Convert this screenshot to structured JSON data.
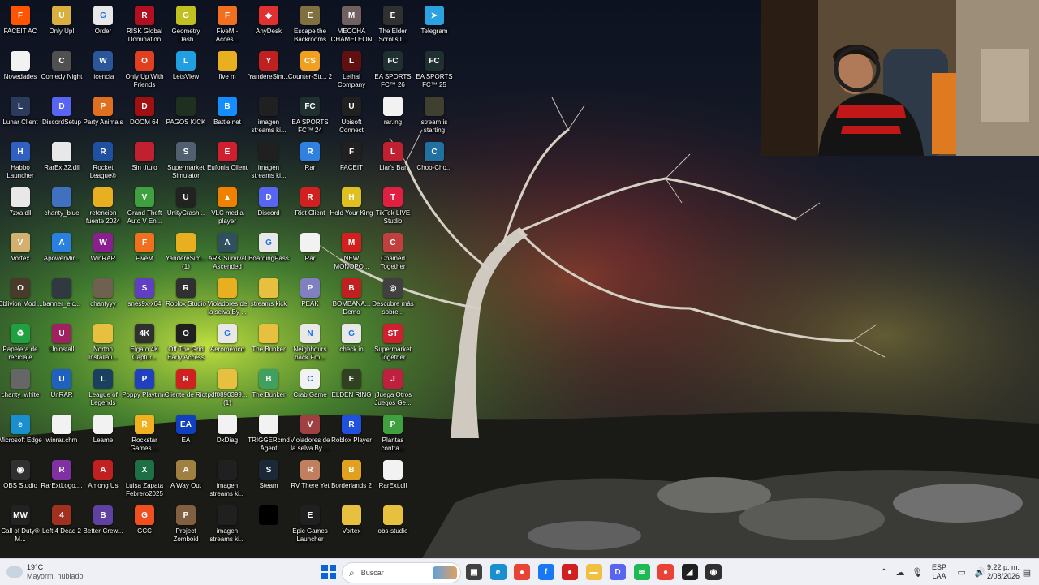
{
  "desktop": {
    "icons": [
      {
        "label": "FACEIT AC",
        "color": "#ff5500",
        "glyph": "F"
      },
      {
        "label": "Novedades",
        "color": "#f2f2f2",
        "glyph": ""
      },
      {
        "label": "Lunar Client",
        "color": "#2a3b5c",
        "glyph": "L"
      },
      {
        "label": "Habbo Launcher",
        "color": "#3060c0",
        "glyph": "H"
      },
      {
        "label": "7zxa.dll",
        "color": "#e8e8e8",
        "glyph": ""
      },
      {
        "label": "Vortex",
        "color": "#d4b070",
        "glyph": "V"
      },
      {
        "label": "Oblivion Mod ...",
        "color": "#4a3a2a",
        "glyph": "O"
      },
      {
        "label": "Papelera de reciclaje",
        "color": "#20a040",
        "glyph": "♻"
      },
      {
        "label": "chanty_white",
        "color": "#666666",
        "glyph": ""
      },
      {
        "label": "Microsoft Edge",
        "color": "#1a8fd0",
        "glyph": "e"
      },
      {
        "label": "OBS Studio",
        "color": "#303030",
        "glyph": "◉"
      },
      {
        "label": "Call of Duty® M...",
        "color": "#222222",
        "glyph": "MW"
      },
      {
        "label": "Only Up!",
        "color": "#d9b040",
        "glyph": "U"
      },
      {
        "label": "Comedy Night",
        "color": "#505050",
        "glyph": "C"
      },
      {
        "label": "DiscordSetup",
        "color": "#5865f2",
        "glyph": "D"
      },
      {
        "label": "RarExt32.dll",
        "color": "#e8e8e8",
        "glyph": ""
      },
      {
        "label": "chanty_blue",
        "color": "#4070c0",
        "glyph": ""
      },
      {
        "label": "ApowerMir...",
        "color": "#2a80e0",
        "glyph": "A"
      },
      {
        "label": "banner_elc...",
        "color": "#303840",
        "glyph": ""
      },
      {
        "label": "Uninstall",
        "color": "#a02060",
        "glyph": "U"
      },
      {
        "label": "UnRAR",
        "color": "#2060c0",
        "glyph": "U"
      },
      {
        "label": "winrar.chm",
        "color": "#f2f2f2",
        "glyph": ""
      },
      {
        "label": "RarExtLogo....",
        "color": "#8030a0",
        "glyph": "R"
      },
      {
        "label": "Left 4 Dead 2",
        "color": "#a03020",
        "glyph": "4"
      },
      {
        "label": "Order",
        "color": "#e8e8e8",
        "glyph": "G"
      },
      {
        "label": "licencia",
        "color": "#2b579a",
        "glyph": "W"
      },
      {
        "label": "Party Animals",
        "color": "#e07020",
        "glyph": "P"
      },
      {
        "label": "Rocket League®",
        "color": "#2050a0",
        "glyph": "R"
      },
      {
        "label": "retencion fuente 2024",
        "color": "#e8b020",
        "glyph": ""
      },
      {
        "label": "WinRAR",
        "color": "#8a2090",
        "glyph": "W"
      },
      {
        "label": "chantyyy",
        "color": "#706050",
        "glyph": ""
      },
      {
        "label": "Norton Installati...",
        "color": "#e8c040",
        "glyph": ""
      },
      {
        "label": "League of Legends",
        "color": "#1a4060",
        "glyph": "L"
      },
      {
        "label": "Leame",
        "color": "#f2f2f2",
        "glyph": ""
      },
      {
        "label": "Among Us",
        "color": "#c02020",
        "glyph": "A"
      },
      {
        "label": "Better-Crew...",
        "color": "#6040a0",
        "glyph": "B"
      },
      {
        "label": "RISK Global Domination",
        "color": "#b01020",
        "glyph": "R"
      },
      {
        "label": "Only Up With Friends",
        "color": "#e04020",
        "glyph": "O"
      },
      {
        "label": "DOOM 64",
        "color": "#a01010",
        "glyph": "D"
      },
      {
        "label": "Sin título",
        "color": "#c02030",
        "glyph": ""
      },
      {
        "label": "Grand Theft Auto V En...",
        "color": "#40a040",
        "glyph": "V"
      },
      {
        "label": "FiveM",
        "color": "#f07020",
        "glyph": "F"
      },
      {
        "label": "snes9x-x64",
        "color": "#6040c0",
        "glyph": "S"
      },
      {
        "label": "Elgato 4K Captur...",
        "color": "#303030",
        "glyph": "4K"
      },
      {
        "label": "Poppy Playtime",
        "color": "#2040c0",
        "glyph": "P"
      },
      {
        "label": "Rockstar Games ...",
        "color": "#f0b020",
        "glyph": "R"
      },
      {
        "label": "Luisa Zapata Febrero2025",
        "color": "#1d7044",
        "glyph": "X"
      },
      {
        "label": "GCC",
        "color": "#f05020",
        "glyph": "G"
      },
      {
        "label": "Geometry Dash",
        "color": "#c0c020",
        "glyph": "G"
      },
      {
        "label": "LetsView",
        "color": "#20a0e0",
        "glyph": "L"
      },
      {
        "label": "PAGOS KICK",
        "color": "#203020",
        "glyph": ""
      },
      {
        "label": "Supermarket Simulator",
        "color": "#506070",
        "glyph": "S"
      },
      {
        "label": "UnityCrash...",
        "color": "#222222",
        "glyph": "U"
      },
      {
        "label": "YandereSim... (1)",
        "color": "#e8b020",
        "glyph": ""
      },
      {
        "label": "Roblox Studio",
        "color": "#303030",
        "glyph": "R"
      },
      {
        "label": "Off The Grid Early Access",
        "color": "#202020",
        "glyph": "O"
      },
      {
        "label": "Cliente de Riot",
        "color": "#d02020",
        "glyph": "R"
      },
      {
        "label": "EA",
        "color": "#1040c0",
        "glyph": "EA"
      },
      {
        "label": "A Way Out",
        "color": "#a08040",
        "glyph": "A"
      },
      {
        "label": "Project Zomboid",
        "color": "#806040",
        "glyph": "P"
      },
      {
        "label": "FiveM - Acces...",
        "color": "#f07020",
        "glyph": "F"
      },
      {
        "label": "five m",
        "color": "#e8b020",
        "glyph": ""
      },
      {
        "label": "Battle.net",
        "color": "#148eff",
        "glyph": "B"
      },
      {
        "label": "Eufonia Client",
        "color": "#d02030",
        "glyph": "E"
      },
      {
        "label": "VLC media player",
        "color": "#f08000",
        "glyph": "▲"
      },
      {
        "label": "ARK Survival Ascended",
        "color": "#305060",
        "glyph": "A"
      },
      {
        "label": "Violadores de la selva By ...",
        "color": "#e8b020",
        "glyph": ""
      },
      {
        "label": "Aeroméxico",
        "color": "#e8e8e8",
        "glyph": "G"
      },
      {
        "label": "pdf0890399... (1)",
        "color": "#e8c040",
        "glyph": ""
      },
      {
        "label": "DxDiag",
        "color": "#f2f2f2",
        "glyph": ""
      },
      {
        "label": "imagen streams ki...",
        "color": "#202020",
        "glyph": ""
      },
      {
        "label": "imagen streams ki...",
        "color": "#202020",
        "glyph": ""
      },
      {
        "label": "AnyDesk",
        "color": "#e03030",
        "glyph": "◆"
      },
      {
        "label": "YandereSim...",
        "color": "#c02020",
        "glyph": "Y"
      },
      {
        "label": "imagen streams ki...",
        "color": "#202020",
        "glyph": ""
      },
      {
        "label": "imagen streams ki...",
        "color": "#202020",
        "glyph": ""
      },
      {
        "label": "Discord",
        "color": "#5865f2",
        "glyph": "D"
      },
      {
        "label": "BoardingPass",
        "color": "#e8e8e8",
        "glyph": "G"
      },
      {
        "label": "streams kick",
        "color": "#e8c040",
        "glyph": ""
      },
      {
        "label": "The Bunker",
        "color": "#e8c040",
        "glyph": ""
      },
      {
        "label": "The Bunker",
        "color": "#40a060",
        "glyph": "B"
      },
      {
        "label": "TRIGGERcmd Agent",
        "color": "#f2f2f2",
        "glyph": ""
      },
      {
        "label": "Steam",
        "color": "#1b2838",
        "glyph": "S"
      },
      {
        "label": "",
        "color": "#000000",
        "glyph": ""
      },
      {
        "label": "Escape the Backrooms",
        "color": "#807040",
        "glyph": "E"
      },
      {
        "label": "Counter-Str... 2",
        "color": "#f0a020",
        "glyph": "CS"
      },
      {
        "label": "EA SPORTS FC™ 24",
        "color": "#203030",
        "glyph": "FC"
      },
      {
        "label": "Rar",
        "color": "#3080e0",
        "glyph": "R"
      },
      {
        "label": "Riot Client",
        "color": "#d02020",
        "glyph": "R"
      },
      {
        "label": "Rar",
        "color": "#f2f2f2",
        "glyph": ""
      },
      {
        "label": "PEAK",
        "color": "#8080c0",
        "glyph": "P"
      },
      {
        "label": "Neighbours back Fro...",
        "color": "#e8e8e8",
        "glyph": "N"
      },
      {
        "label": "Crab Game",
        "color": "#f2f2f2",
        "glyph": "C"
      },
      {
        "label": "Violadores de la selva By ...",
        "color": "#a04040",
        "glyph": "V"
      },
      {
        "label": "RV There Yet",
        "color": "#c08060",
        "glyph": "R"
      },
      {
        "label": "Epic Games Launcher",
        "color": "#202020",
        "glyph": "E"
      },
      {
        "label": "MECCHA CHAMELEON",
        "color": "#706060",
        "glyph": "M"
      },
      {
        "label": "Lethal Company",
        "color": "#601010",
        "glyph": "L"
      },
      {
        "label": "Ubisoft Connect",
        "color": "#202020",
        "glyph": "U"
      },
      {
        "label": "FACEIT",
        "color": "#202020",
        "glyph": "F"
      },
      {
        "label": "Hold Your King",
        "color": "#e0c020",
        "glyph": "H"
      },
      {
        "label": "NEW MONOPO...",
        "color": "#d02020",
        "glyph": "M"
      },
      {
        "label": "BOMBANA... Demo",
        "color": "#c02020",
        "glyph": "B"
      },
      {
        "label": "check in",
        "color": "#e8e8e8",
        "glyph": "G"
      },
      {
        "label": "ELDEN RING",
        "color": "#304020",
        "glyph": "E"
      },
      {
        "label": "Roblox Player",
        "color": "#2050e0",
        "glyph": "R"
      },
      {
        "label": "Borderlands 2",
        "color": "#e0a020",
        "glyph": "B"
      },
      {
        "label": "Vortex",
        "color": "#e8c040",
        "glyph": ""
      },
      {
        "label": "The Elder Scrolls I...",
        "color": "#303030",
        "glyph": "E"
      },
      {
        "label": "EA SPORTS FC™ 26",
        "color": "#203030",
        "glyph": "FC"
      },
      {
        "label": "rar.lng",
        "color": "#f2f2f2",
        "glyph": ""
      },
      {
        "label": "Liar's Bar",
        "color": "#c02030",
        "glyph": "L"
      },
      {
        "label": "TikTok LIVE Studio",
        "color": "#e02040",
        "glyph": "T"
      },
      {
        "label": "Chained Together",
        "color": "#c04040",
        "glyph": "C"
      },
      {
        "label": "Descubre más sobre...",
        "color": "#404040",
        "glyph": "◎"
      },
      {
        "label": "Supermarket Together",
        "color": "#d02030",
        "glyph": "ST"
      },
      {
        "label": "¡Juega Otros Juegos Ge...",
        "color": "#c02040",
        "glyph": "J"
      },
      {
        "label": "Plantas contra...",
        "color": "#40a040",
        "glyph": "P"
      },
      {
        "label": "RarExt.dll",
        "color": "#f2f2f2",
        "glyph": ""
      },
      {
        "label": "obs-studio",
        "color": "#e8c040",
        "glyph": ""
      },
      {
        "label": "Telegram",
        "color": "#2aa3e0",
        "glyph": "➤"
      },
      {
        "label": "EA SPORTS FC™ 25",
        "color": "#203030",
        "glyph": "FC"
      },
      {
        "label": "stream is starting",
        "color": "#404030",
        "glyph": ""
      },
      {
        "label": "Choo-Cho...",
        "color": "#2070a0",
        "glyph": "C"
      }
    ]
  },
  "taskbar": {
    "weather_temp": "19°C",
    "weather_desc": "Mayorm. nublado",
    "search_placeholder": "Buscar",
    "language": "ESP",
    "language_sub": "LAA",
    "time": "9:22 p. m.",
    "date": "2/08/2026",
    "pinned": [
      {
        "name": "task-view-icon",
        "color": "#404040",
        "glyph": "▣"
      },
      {
        "name": "edge-icon",
        "color": "#1a8fd0",
        "glyph": "e"
      },
      {
        "name": "chrome-icon",
        "color": "#ea4335",
        "glyph": "●"
      },
      {
        "name": "facebook-icon",
        "color": "#1877f2",
        "glyph": "f"
      },
      {
        "name": "app-red-icon",
        "color": "#d02020",
        "glyph": "●"
      },
      {
        "name": "file-explorer-icon",
        "color": "#f0c040",
        "glyph": "▬"
      },
      {
        "name": "discord-icon",
        "color": "#5865f2",
        "glyph": "D"
      },
      {
        "name": "spotify-icon",
        "color": "#1db954",
        "glyph": "≋"
      },
      {
        "name": "chrome-active-icon",
        "color": "#ea4335",
        "glyph": "●"
      },
      {
        "name": "app-dark-icon",
        "color": "#202020",
        "glyph": "◢"
      },
      {
        "name": "obs-icon",
        "color": "#303030",
        "glyph": "◉"
      }
    ]
  }
}
